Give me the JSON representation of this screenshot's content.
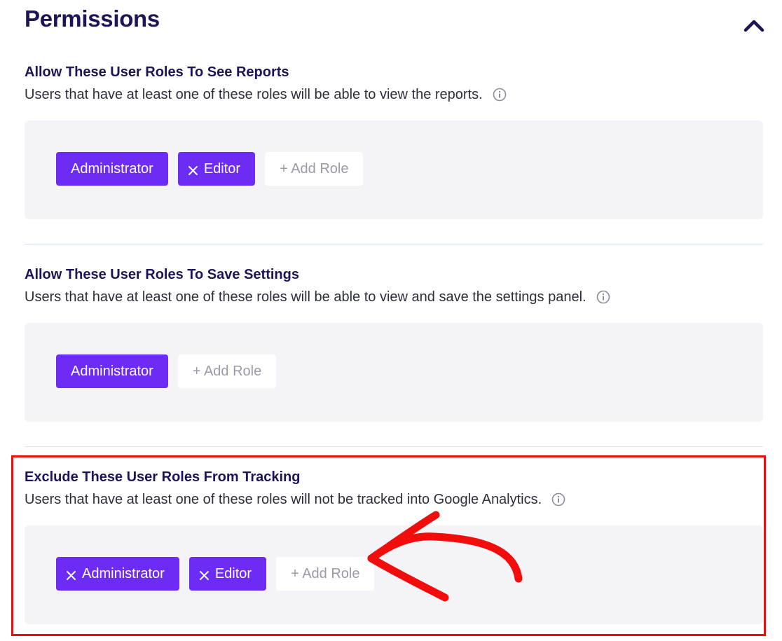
{
  "page": {
    "title": "Permissions"
  },
  "sections": [
    {
      "heading": "Allow These User Roles To See Reports",
      "description": "Users that have at least one of these roles will be able to view the reports.",
      "roles": [
        "Administrator",
        "Editor"
      ],
      "add_label": "+ Add Role"
    },
    {
      "heading": "Allow These User Roles To Save Settings",
      "description": "Users that have at least one of these roles will be able to view and save the settings panel.",
      "roles": [
        "Administrator"
      ],
      "add_label": "+ Add Role"
    },
    {
      "heading": "Exclude These User Roles From Tracking",
      "description": "Users that have at least one of these roles will not be tracked into Google Analytics.",
      "roles": [
        "Administrator",
        "Editor"
      ],
      "add_label": "+ Add Role"
    }
  ],
  "icons": {
    "collapse": "chevron-up-icon",
    "info": "info-icon",
    "remove": "close-icon"
  },
  "colors": {
    "accent": "#6c2cf6",
    "heading": "#1e1458",
    "panel": "#f4f4f8",
    "highlight": "#f20d0d"
  }
}
